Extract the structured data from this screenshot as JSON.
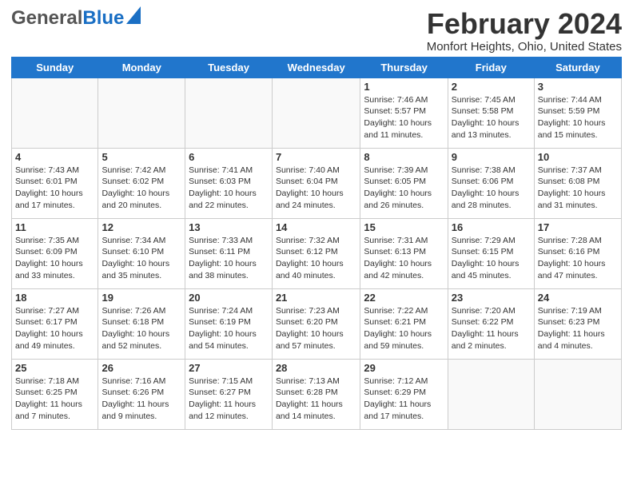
{
  "header": {
    "logo_general": "General",
    "logo_blue": "Blue",
    "title": "February 2024",
    "location": "Monfort Heights, Ohio, United States"
  },
  "weekdays": [
    "Sunday",
    "Monday",
    "Tuesday",
    "Wednesday",
    "Thursday",
    "Friday",
    "Saturday"
  ],
  "weeks": [
    [
      {
        "day": "",
        "info": ""
      },
      {
        "day": "",
        "info": ""
      },
      {
        "day": "",
        "info": ""
      },
      {
        "day": "",
        "info": ""
      },
      {
        "day": "1",
        "info": "Sunrise: 7:46 AM\nSunset: 5:57 PM\nDaylight: 10 hours\nand 11 minutes."
      },
      {
        "day": "2",
        "info": "Sunrise: 7:45 AM\nSunset: 5:58 PM\nDaylight: 10 hours\nand 13 minutes."
      },
      {
        "day": "3",
        "info": "Sunrise: 7:44 AM\nSunset: 5:59 PM\nDaylight: 10 hours\nand 15 minutes."
      }
    ],
    [
      {
        "day": "4",
        "info": "Sunrise: 7:43 AM\nSunset: 6:01 PM\nDaylight: 10 hours\nand 17 minutes."
      },
      {
        "day": "5",
        "info": "Sunrise: 7:42 AM\nSunset: 6:02 PM\nDaylight: 10 hours\nand 20 minutes."
      },
      {
        "day": "6",
        "info": "Sunrise: 7:41 AM\nSunset: 6:03 PM\nDaylight: 10 hours\nand 22 minutes."
      },
      {
        "day": "7",
        "info": "Sunrise: 7:40 AM\nSunset: 6:04 PM\nDaylight: 10 hours\nand 24 minutes."
      },
      {
        "day": "8",
        "info": "Sunrise: 7:39 AM\nSunset: 6:05 PM\nDaylight: 10 hours\nand 26 minutes."
      },
      {
        "day": "9",
        "info": "Sunrise: 7:38 AM\nSunset: 6:06 PM\nDaylight: 10 hours\nand 28 minutes."
      },
      {
        "day": "10",
        "info": "Sunrise: 7:37 AM\nSunset: 6:08 PM\nDaylight: 10 hours\nand 31 minutes."
      }
    ],
    [
      {
        "day": "11",
        "info": "Sunrise: 7:35 AM\nSunset: 6:09 PM\nDaylight: 10 hours\nand 33 minutes."
      },
      {
        "day": "12",
        "info": "Sunrise: 7:34 AM\nSunset: 6:10 PM\nDaylight: 10 hours\nand 35 minutes."
      },
      {
        "day": "13",
        "info": "Sunrise: 7:33 AM\nSunset: 6:11 PM\nDaylight: 10 hours\nand 38 minutes."
      },
      {
        "day": "14",
        "info": "Sunrise: 7:32 AM\nSunset: 6:12 PM\nDaylight: 10 hours\nand 40 minutes."
      },
      {
        "day": "15",
        "info": "Sunrise: 7:31 AM\nSunset: 6:13 PM\nDaylight: 10 hours\nand 42 minutes."
      },
      {
        "day": "16",
        "info": "Sunrise: 7:29 AM\nSunset: 6:15 PM\nDaylight: 10 hours\nand 45 minutes."
      },
      {
        "day": "17",
        "info": "Sunrise: 7:28 AM\nSunset: 6:16 PM\nDaylight: 10 hours\nand 47 minutes."
      }
    ],
    [
      {
        "day": "18",
        "info": "Sunrise: 7:27 AM\nSunset: 6:17 PM\nDaylight: 10 hours\nand 49 minutes."
      },
      {
        "day": "19",
        "info": "Sunrise: 7:26 AM\nSunset: 6:18 PM\nDaylight: 10 hours\nand 52 minutes."
      },
      {
        "day": "20",
        "info": "Sunrise: 7:24 AM\nSunset: 6:19 PM\nDaylight: 10 hours\nand 54 minutes."
      },
      {
        "day": "21",
        "info": "Sunrise: 7:23 AM\nSunset: 6:20 PM\nDaylight: 10 hours\nand 57 minutes."
      },
      {
        "day": "22",
        "info": "Sunrise: 7:22 AM\nSunset: 6:21 PM\nDaylight: 10 hours\nand 59 minutes."
      },
      {
        "day": "23",
        "info": "Sunrise: 7:20 AM\nSunset: 6:22 PM\nDaylight: 11 hours\nand 2 minutes."
      },
      {
        "day": "24",
        "info": "Sunrise: 7:19 AM\nSunset: 6:23 PM\nDaylight: 11 hours\nand 4 minutes."
      }
    ],
    [
      {
        "day": "25",
        "info": "Sunrise: 7:18 AM\nSunset: 6:25 PM\nDaylight: 11 hours\nand 7 minutes."
      },
      {
        "day": "26",
        "info": "Sunrise: 7:16 AM\nSunset: 6:26 PM\nDaylight: 11 hours\nand 9 minutes."
      },
      {
        "day": "27",
        "info": "Sunrise: 7:15 AM\nSunset: 6:27 PM\nDaylight: 11 hours\nand 12 minutes."
      },
      {
        "day": "28",
        "info": "Sunrise: 7:13 AM\nSunset: 6:28 PM\nDaylight: 11 hours\nand 14 minutes."
      },
      {
        "day": "29",
        "info": "Sunrise: 7:12 AM\nSunset: 6:29 PM\nDaylight: 11 hours\nand 17 minutes."
      },
      {
        "day": "",
        "info": ""
      },
      {
        "day": "",
        "info": ""
      }
    ]
  ]
}
